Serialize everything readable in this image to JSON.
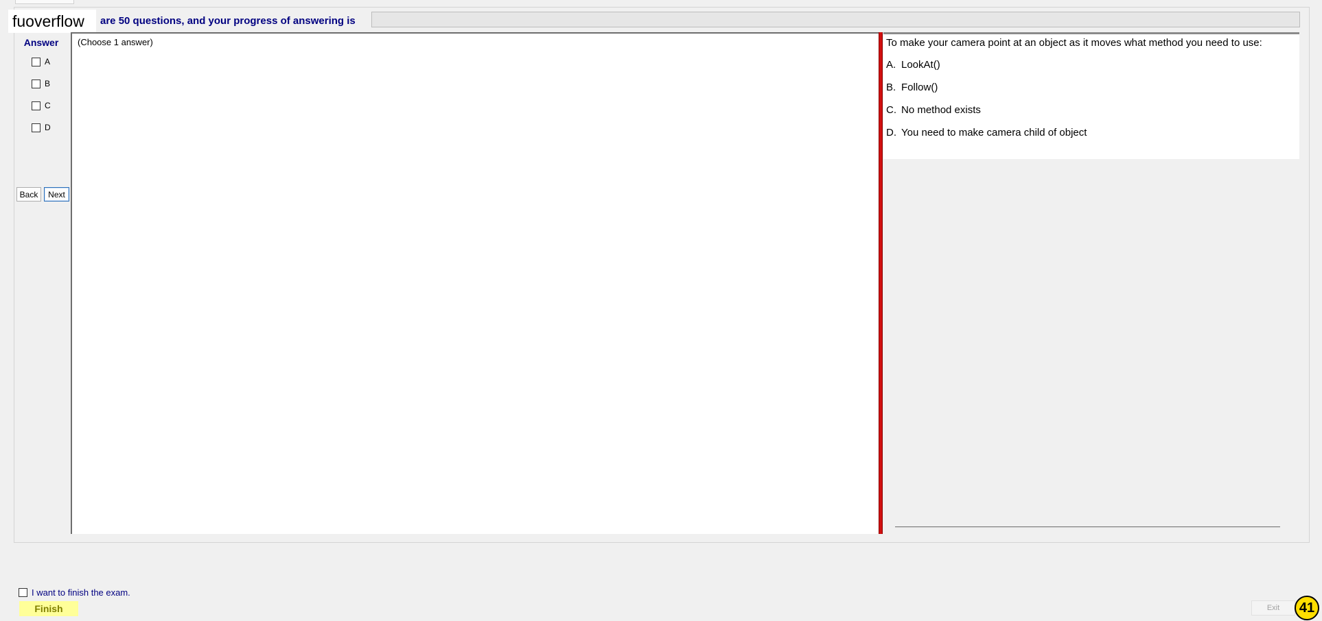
{
  "header": {
    "brand": "fuoverflow",
    "status_text": "are 50 questions, and your progress of answering is",
    "progress_fraction": 0
  },
  "answer_panel": {
    "title": "Answer",
    "options": [
      "A",
      "B",
      "C",
      "D"
    ],
    "back_label": "Back",
    "next_label": "Next"
  },
  "center": {
    "hint": "(Choose 1 answer)"
  },
  "question": {
    "text": "To make your camera point at an object as it moves what method you need to use:",
    "choices": [
      {
        "key": "A.",
        "text": "LookAt()"
      },
      {
        "key": "B.",
        "text": "Follow()"
      },
      {
        "key": "C.",
        "text": "No method exists"
      },
      {
        "key": "D.",
        "text": "You need to make camera child of object"
      }
    ]
  },
  "footer": {
    "finish_confirm_label": "I want to finish the exam.",
    "finish_label": "Finish",
    "exit_label": "Exit",
    "counter": "41"
  },
  "colors": {
    "accent_text": "#000080",
    "splitter": "#d01010",
    "finish_bg": "#ffff99",
    "badge_bg": "#ffdd00"
  }
}
